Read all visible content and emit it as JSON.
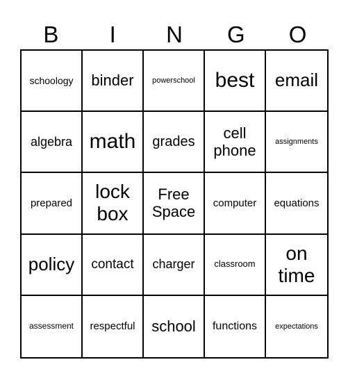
{
  "header": {
    "letters": [
      "B",
      "I",
      "N",
      "G",
      "O"
    ]
  },
  "cells": [
    "schoology",
    "binder",
    "powerschool",
    "best",
    "email",
    "algebra",
    "math",
    "grades",
    "cell phone",
    "assignments",
    "prepared",
    "lock box",
    "Free Space",
    "computer",
    "equations",
    "policy",
    "contact",
    "charger",
    "classroom",
    "on time",
    "assessment",
    "respectful",
    "school",
    "functions",
    "expectations"
  ]
}
